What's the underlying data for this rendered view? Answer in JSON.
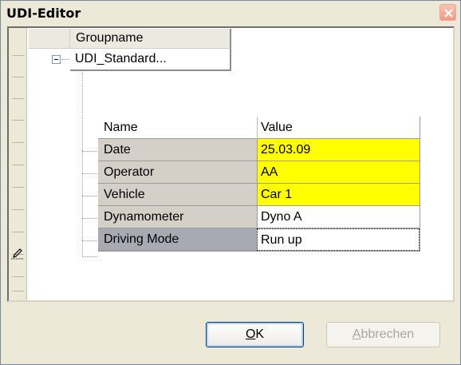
{
  "window": {
    "title": "UDI-Editor"
  },
  "tree": {
    "group_header": "Groupname",
    "group_name": "UDI_Standard...",
    "expanded": true
  },
  "grid": {
    "columns": [
      "Name",
      "Value"
    ],
    "rows": [
      {
        "name": "Date",
        "value": "25.03.09",
        "highlight": "#ffff00"
      },
      {
        "name": "Operator",
        "value": "AA",
        "highlight": "#ffff00"
      },
      {
        "name": "Vehicle",
        "value": "Car 1",
        "highlight": "#ffff00"
      },
      {
        "name": "Dynamometer",
        "value": "Dyno A",
        "highlight": null
      },
      {
        "name": "Driving Mode",
        "value": "Run up",
        "highlight": null,
        "selected": true
      }
    ]
  },
  "buttons": {
    "ok": {
      "mnemonic": "O",
      "rest": "K"
    },
    "cancel": {
      "mnemonic": "A",
      "rest": "bbrechen",
      "enabled": false
    }
  },
  "icons": {
    "close": "close-icon",
    "row_editing": "pencil-icon",
    "expand": "collapse-minus-icon"
  },
  "colors": {
    "required_field": "#ffff00",
    "selected_row": "#a9a9b4",
    "dialog_background": "#ece9d8"
  }
}
